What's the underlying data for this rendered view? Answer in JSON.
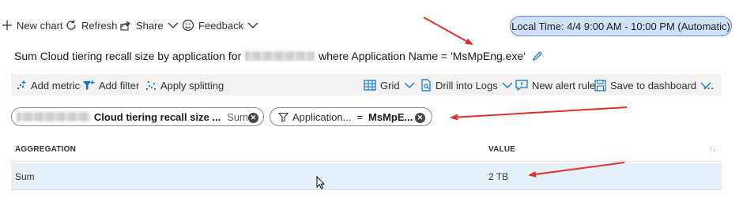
{
  "toolbar": {
    "new_chart": "New chart",
    "refresh": "Refresh",
    "share": "Share",
    "feedback": "Feedback",
    "local_time": "Local Time: 4/4 9:00 AM - 10:00 PM (Automatic)"
  },
  "chart": {
    "title_prefix": "Sum Cloud tiering recall size by application for",
    "title_suffix": "where Application Name = 'MsMpEng.exe'"
  },
  "commands": {
    "add_metric": "Add metric",
    "add_filter": "Add filter",
    "apply_splitting": "Apply splitting",
    "grid": "Grid",
    "drill_into_logs": "Drill into Logs",
    "new_alert_rule": "New alert rule",
    "save_to_dashboard": "Save to dashboard",
    "more": "..."
  },
  "pills": {
    "metric_name": "Cloud tiering recall size ...",
    "metric_agg": "Sum",
    "filter_name": "Application...",
    "filter_op": "=",
    "filter_value": "MsMpE..."
  },
  "grid": {
    "col_aggregation": "AGGREGATION",
    "col_value": "VALUE",
    "sort_icon": "↑↓",
    "rows": [
      {
        "aggregation": "Sum",
        "value": "2 TB"
      }
    ]
  },
  "colors": {
    "accent": "#0078d4",
    "annotation": "#e0302a",
    "pill_bg": "#cfe2fb",
    "row_selected": "#e6f0fb"
  }
}
